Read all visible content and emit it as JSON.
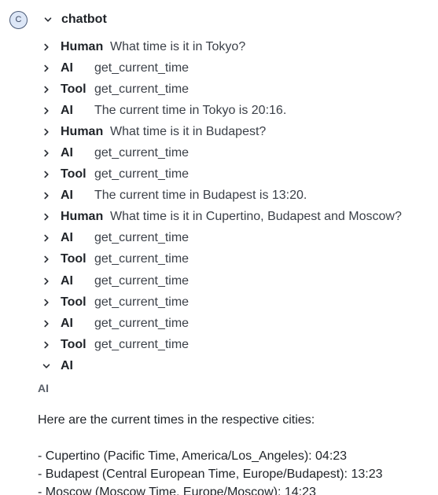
{
  "root": {
    "avatar_letter": "C",
    "title": "chatbot"
  },
  "messages": [
    {
      "role": "Human",
      "text": "What time is it in Tokyo?"
    },
    {
      "role": "AI",
      "text": "get_current_time"
    },
    {
      "role": "Tool",
      "text": "get_current_time"
    },
    {
      "role": "AI",
      "text": "The current time in Tokyo is 20:16."
    },
    {
      "role": "Human",
      "text": "What time is it in Budapest?"
    },
    {
      "role": "AI",
      "text": "get_current_time"
    },
    {
      "role": "Tool",
      "text": "get_current_time"
    },
    {
      "role": "AI",
      "text": "The current time in Budapest is 13:20."
    },
    {
      "role": "Human",
      "text": "What time is it in Cupertino, Budapest and Moscow?"
    },
    {
      "role": "AI",
      "text": "get_current_time"
    },
    {
      "role": "Tool",
      "text": "get_current_time"
    },
    {
      "role": "AI",
      "text": "get_current_time"
    },
    {
      "role": "Tool",
      "text": "get_current_time"
    },
    {
      "role": "AI",
      "text": "get_current_time"
    },
    {
      "role": "Tool",
      "text": "get_current_time"
    }
  ],
  "expanded": {
    "role": "AI",
    "detail_role": "AI",
    "intro": "Here are the current times in the respective cities:",
    "lines": [
      "- Cupertino (Pacific Time, America/Los_Angeles): 04:23",
      "- Budapest (Central European Time, Europe/Budapest): 13:23",
      "- Moscow (Moscow Time, Europe/Moscow): 14:23"
    ]
  }
}
